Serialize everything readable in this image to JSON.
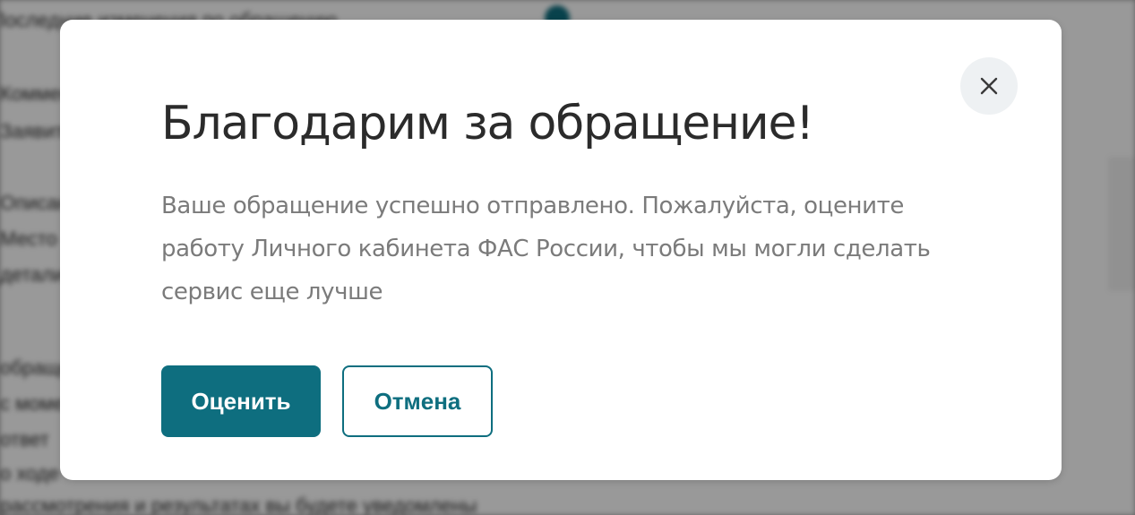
{
  "modal": {
    "title": "Благодарим за обращение!",
    "message": "Ваше обращение успешно отправлено. Пожалуйста, оцените работу Личного кабинета ФАС России, чтобы мы могли сделать сервис еще лучше",
    "rate_label": "Оценить",
    "cancel_label": "Отмена",
    "close_icon": "close-icon"
  },
  "colors": {
    "accent": "#0e6e7f",
    "title_text": "#2b2b2b",
    "message_text": "#7b7b7b",
    "close_bg": "#eef1f3"
  }
}
